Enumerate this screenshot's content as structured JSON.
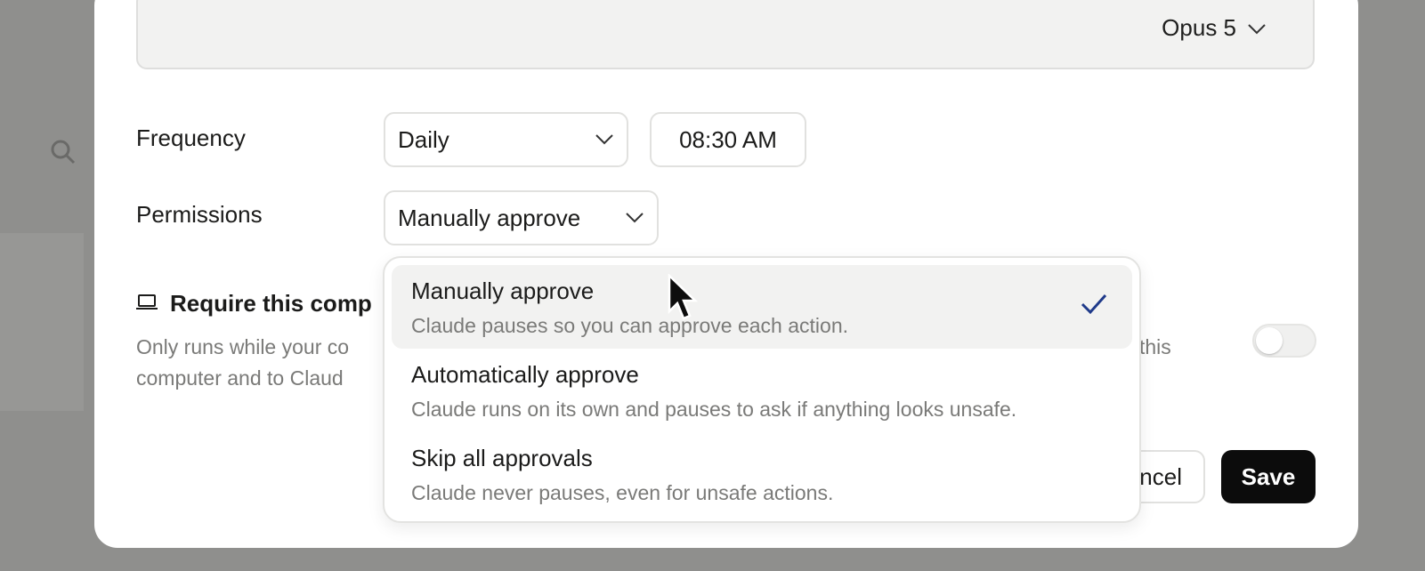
{
  "composer": {
    "model_label": "Opus 5"
  },
  "frequency": {
    "label": "Frequency",
    "value": "Daily",
    "time": "08:30 AM"
  },
  "permissions": {
    "label": "Permissions",
    "value": "Manually approve",
    "options": [
      {
        "title": "Manually approve",
        "desc": "Claude pauses so you can approve each action.",
        "selected": true
      },
      {
        "title": "Automatically approve",
        "desc": "Claude runs on its own and pauses to ask if anything looks unsafe.",
        "selected": false
      },
      {
        "title": "Skip all approvals",
        "desc": "Claude never pauses, even for unsafe actions.",
        "selected": false
      }
    ]
  },
  "computer": {
    "title_visible": "Require this comp",
    "desc_line1_visible": "Only runs while your co",
    "desc_line1_tail": "this",
    "desc_line2_visible": "computer and to Claud",
    "toggle_on": false
  },
  "buttons": {
    "cancel_visible": "ncel",
    "save": "Save"
  },
  "colors": {
    "accent": "#1f3a8a",
    "save_bg": "#0c0c0c"
  },
  "icons": {
    "laptop": "laptop-icon",
    "chevron": "chevron-down-icon",
    "check": "check-icon",
    "search": "search-icon"
  }
}
